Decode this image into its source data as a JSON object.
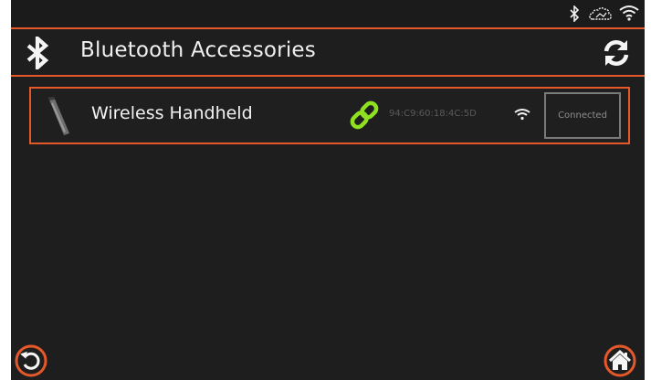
{
  "colors": {
    "accent": "#e5582a",
    "background": "#1e1e1e",
    "link_green": "#8ee020",
    "text": "#f2f2f2"
  },
  "statusbar": {
    "icons": [
      "bluetooth-icon",
      "cloud-icon",
      "wifi-icon"
    ]
  },
  "header": {
    "icon": "bluetooth-icon",
    "title": "Bluetooth Accessories",
    "refresh_icon": "refresh-icon"
  },
  "devices": [
    {
      "icon": "handheld-icon",
      "name": "Wireless Handheld",
      "link_icon": "link-icon",
      "mac": "94:C9:60:18:4C:5D",
      "signal_icon": "signal-icon",
      "status": "Connected"
    }
  ],
  "footer": {
    "back_icon": "back-icon",
    "home_icon": "home-icon"
  }
}
